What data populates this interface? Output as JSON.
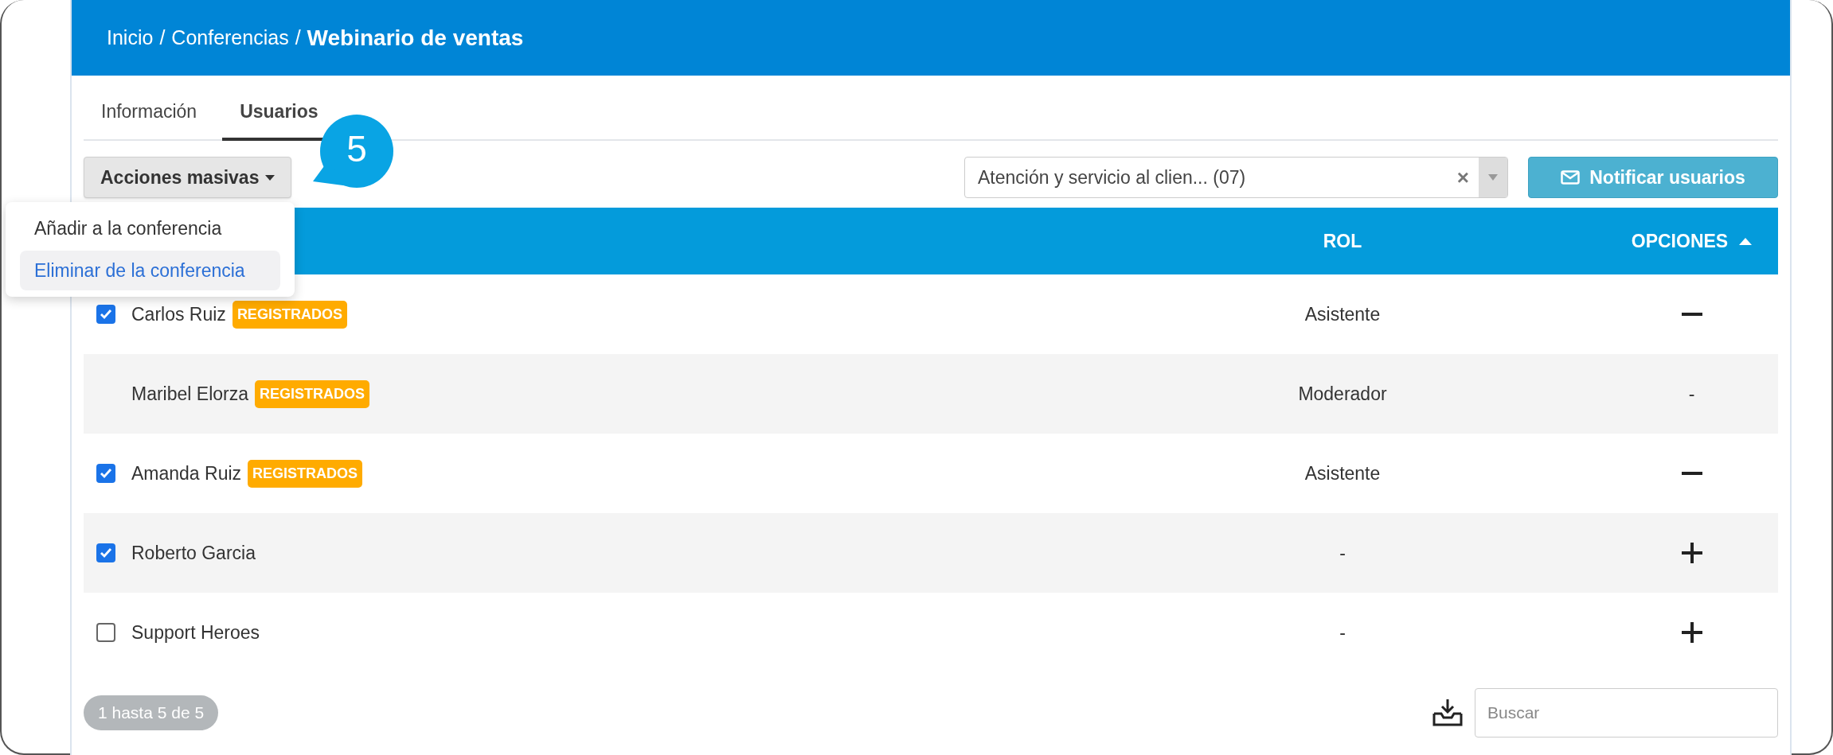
{
  "breadcrumb": {
    "items": [
      "Inicio",
      "Conferencias"
    ],
    "separator": "/",
    "current": "Webinario de ventas"
  },
  "tabs": [
    {
      "label": "Información",
      "selected": false
    },
    {
      "label": "Usuarios",
      "selected": true
    }
  ],
  "bulk_actions": {
    "label": "Acciones masivas",
    "expanded": true,
    "menu": [
      {
        "label": "Añadir a la conferencia",
        "selected": false
      },
      {
        "label": "Eliminar de la conferencia",
        "selected": true
      }
    ]
  },
  "callout": {
    "label": "5"
  },
  "filter": {
    "value": "Atención y servicio al clien... (07)",
    "clear": "×"
  },
  "notify_button": {
    "label": "Notificar usuarios"
  },
  "table": {
    "columns": [
      "ROL",
      "OPCIONES"
    ],
    "rows": [
      {
        "name": "Carlos Ruiz",
        "badge": "REGISTRADOS",
        "checked": true,
        "role": "Asistente",
        "option": {
          "kind": "minus"
        }
      },
      {
        "name": "Maribel Elorza",
        "badge": "REGISTRADOS",
        "role": "Moderador",
        "option": {
          "kind": "text",
          "text": "-"
        }
      },
      {
        "name": "Amanda Ruiz",
        "badge": "REGISTRADOS",
        "checked": true,
        "role": "Asistente",
        "option": {
          "kind": "minus"
        }
      },
      {
        "name": "Roberto Garcia",
        "checked": true,
        "role": "-",
        "option": {
          "kind": "plus"
        }
      },
      {
        "name": "Support Heroes",
        "checked": false,
        "role": "-",
        "option": {
          "kind": "plus"
        }
      }
    ]
  },
  "pagination": {
    "label": "1 hasta 5 de 5"
  },
  "search": {
    "placeholder": "Buscar"
  }
}
